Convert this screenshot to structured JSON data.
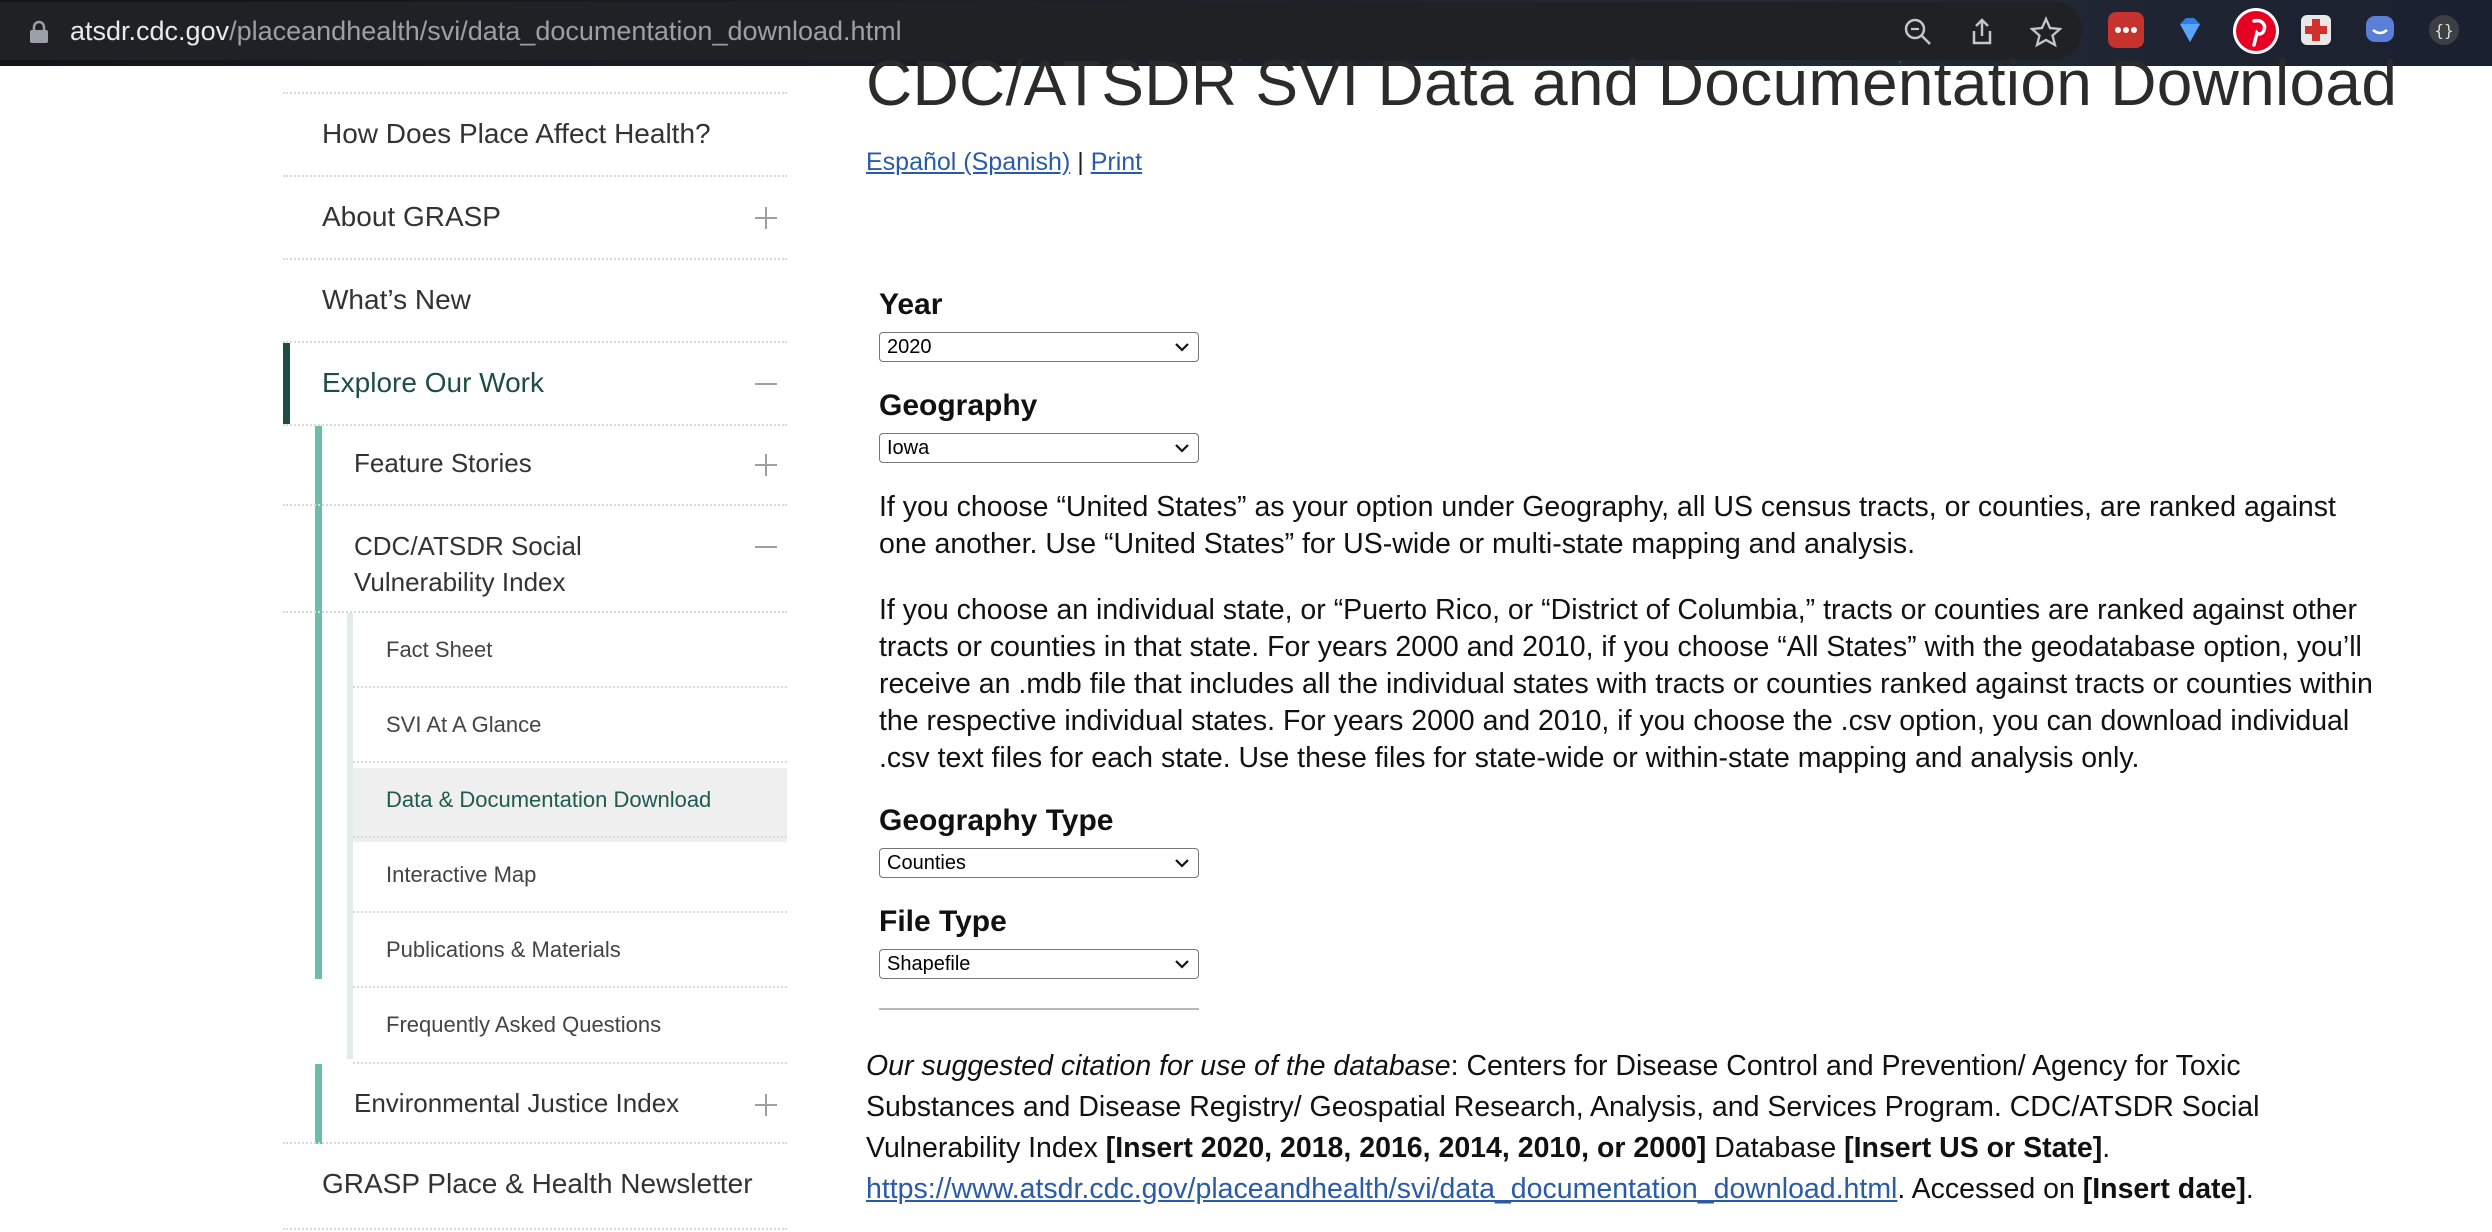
{
  "browser": {
    "url_host": "atsdr.cdc.gov",
    "url_path": "/placeandhealth/svi/data_documentation_download.html",
    "icons": [
      "lock-icon",
      "zoom-icon",
      "share-icon",
      "star-icon",
      "lastpass-extension-icon",
      "gem-extension-icon",
      "pinterest-extension-icon",
      "first-aid-extension-icon",
      "chat-extension-icon",
      "json-extension-icon"
    ]
  },
  "sidebar": {
    "items": [
      {
        "label": "How Does Place Affect Health?"
      },
      {
        "label": "About GRASP"
      },
      {
        "label": "What’s New"
      },
      {
        "label": "Explore Our Work"
      },
      {
        "label": "Feature Stories"
      },
      {
        "label": "CDC/ATSDR Social Vulnerability Index"
      },
      {
        "label": "Fact Sheet"
      },
      {
        "label": "SVI At A Glance"
      },
      {
        "label": "Data & Documentation Download"
      },
      {
        "label": "Interactive Map"
      },
      {
        "label": "Publications & Materials"
      },
      {
        "label": "Frequently Asked Questions"
      },
      {
        "label": "Environmental Justice Index"
      },
      {
        "label": "GRASP Place & Health Newsletter"
      }
    ],
    "colors": {
      "active_text": "#1d5a4f",
      "level1_bar": "#1d4d45",
      "level2_bar": "#6bbfa8"
    }
  },
  "main": {
    "title": "CDC/ATSDR SVI Data and Documentation Download",
    "links": {
      "spanish": "Español (Spanish)",
      "separator": "|",
      "print": "Print"
    },
    "form": {
      "year_label": "Year",
      "year_value": "2020",
      "geography_label": "Geography",
      "geography_value": "Iowa",
      "geo_type_label": "Geography Type",
      "geo_type_value": "Counties",
      "file_type_label": "File Type",
      "file_type_value": "Shapefile"
    },
    "para1": "If you choose “United States” as your option under Geography, all US census tracts, or counties, are ranked against one another. Use “United States” for US-wide or multi-state mapping and analysis.",
    "para2": "If you choose an individual state, or “Puerto Rico, or “District of Columbia,” tracts or counties are ranked against other tracts or counties in that state. For years 2000 and 2010, if you choose “All States” with the geodatabase option, you’ll receive an .mdb file that includes all the individual states with tracts or counties ranked against tracts or counties within the respective individual states. For years 2000 and 2010, if you choose the .csv option, you can download individual .csv text files for each state. Use these files for state-wide or within-state mapping and analysis only.",
    "citation": {
      "lead": "Our suggested citation for use of the database",
      "text1": ": Centers for Disease Control and Prevention/ Agency for Toxic Substances and Disease Registry/ Geospatial Research, Analysis, and Services Program. CDC/ATSDR Social Vulnerability Index ",
      "bold1": "[Insert 2020, 2018, 2016, 2014, 2010, or 2000]",
      "text2": " Database ",
      "bold2": "[Insert US or State]",
      "text3": ".",
      "url": "https://www.atsdr.cdc.gov/placeandhealth/svi/data_documentation_download.html",
      "text4": ". Accessed on ",
      "bold3": "[Insert date]",
      "text5": "."
    }
  }
}
